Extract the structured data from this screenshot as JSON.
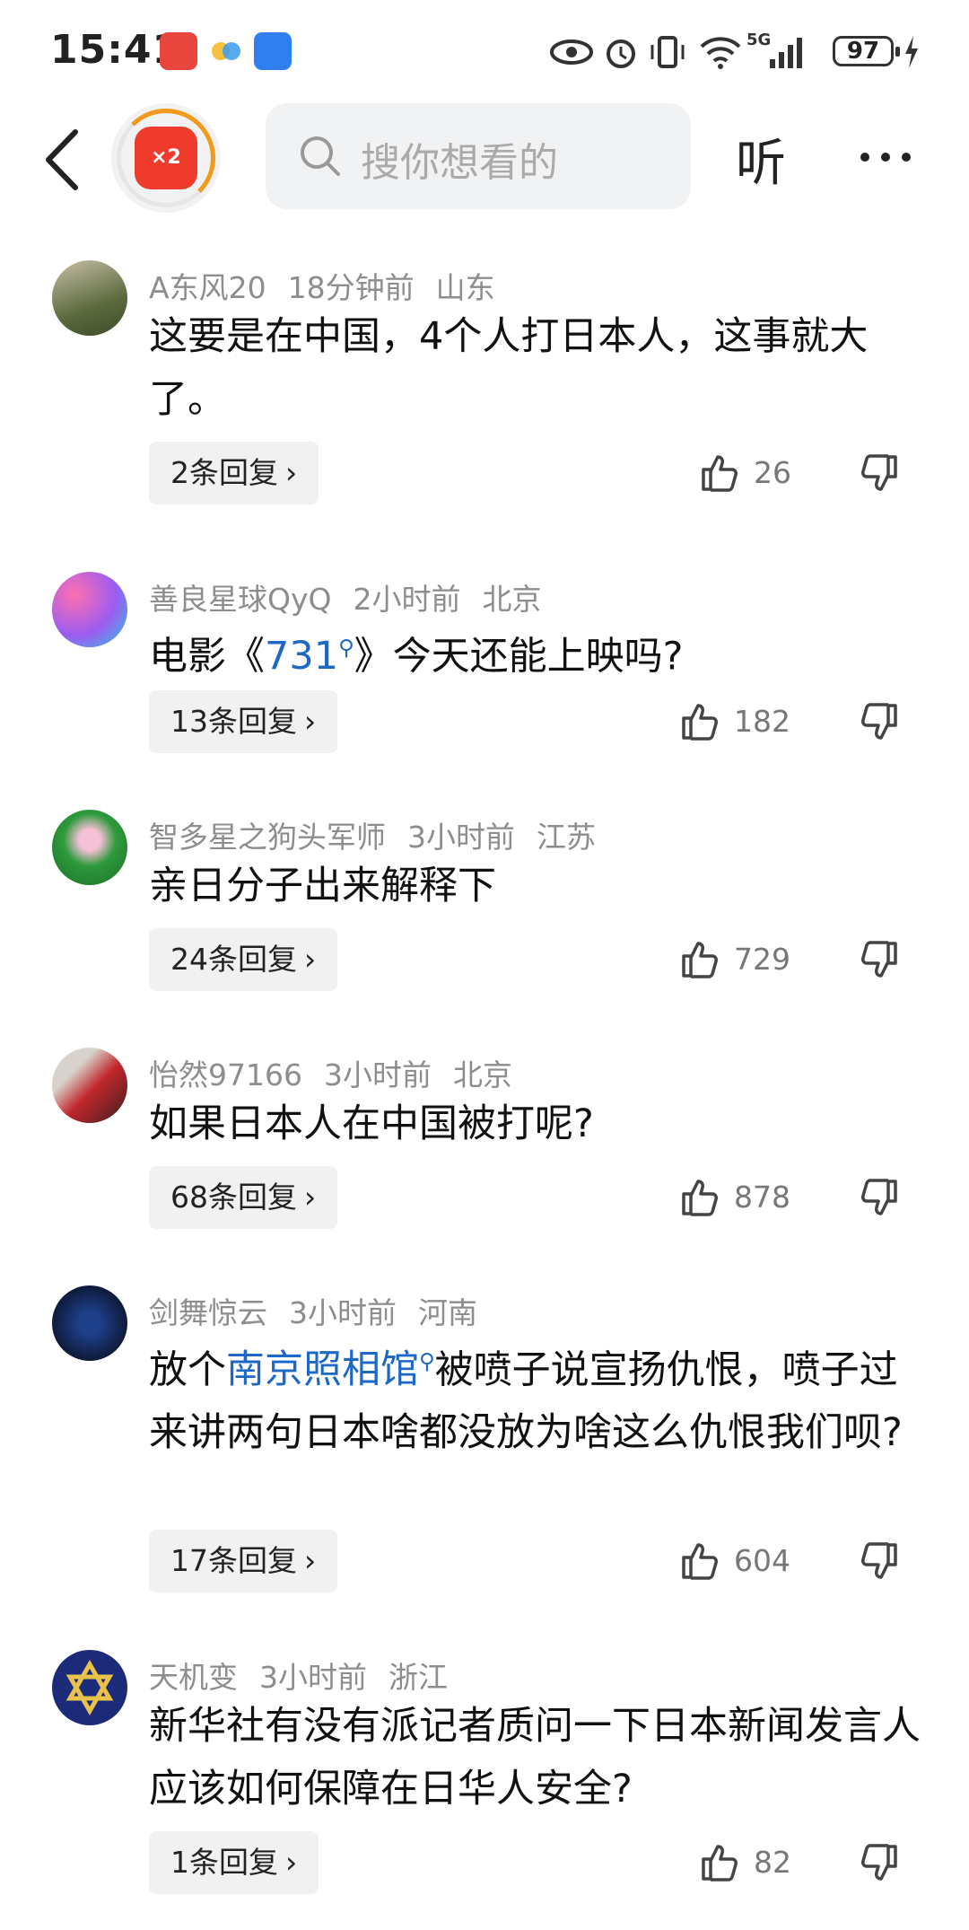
{
  "status_bar": {
    "time": "15:41",
    "network": "5G",
    "battery": "97",
    "icons": [
      "eye-icon",
      "alarm-icon",
      "vibrate-icon",
      "wifi-icon",
      "signal-icon",
      "charging-icon"
    ]
  },
  "top_bar": {
    "redpacket_badge": "×2",
    "search_placeholder": "搜你想看的",
    "listen_label": "听"
  },
  "comments": [
    {
      "user": "A东风20",
      "time": "18分钟前",
      "location": "山东",
      "text_parts": [
        "这要是在中国，4个人打日本人，这事就大了。"
      ],
      "replies": "2条回复",
      "likes": "26"
    },
    {
      "user": "善良星球QyQ",
      "time": "2小时前",
      "location": "北京",
      "text_prefix": "电影《",
      "text_link": "731",
      "text_suffix": "》今天还能上映吗?",
      "replies": "13条回复",
      "likes": "182"
    },
    {
      "user": "智多星之狗头军师",
      "time": "3小时前",
      "location": "江苏",
      "text": "亲日分子出来解释下",
      "replies": "24条回复",
      "likes": "729"
    },
    {
      "user": "怡然97166",
      "time": "3小时前",
      "location": "北京",
      "text": "如果日本人在中国被打呢?",
      "replies": "68条回复",
      "likes": "878"
    },
    {
      "user": "剑舞惊云",
      "time": "3小时前",
      "location": "河南",
      "text_prefix": "放个",
      "text_link": "南京照相馆",
      "text_suffix": "被喷子说宣扬仇恨，喷子过来讲两句日本啥都没放为啥这么仇恨我们呗?",
      "replies": "17条回复",
      "likes": "604"
    },
    {
      "user": "天机变",
      "time": "3小时前",
      "location": "浙江",
      "text": "新华社有没有派记者质问一下日本新闻发言人应该如何保障在日华人安全?",
      "replies": "1条回复",
      "likes": "82"
    }
  ],
  "colors": {
    "link": "#1d67c6",
    "meta": "#8d8d8d",
    "reply_bg": "#f1f1f1"
  }
}
